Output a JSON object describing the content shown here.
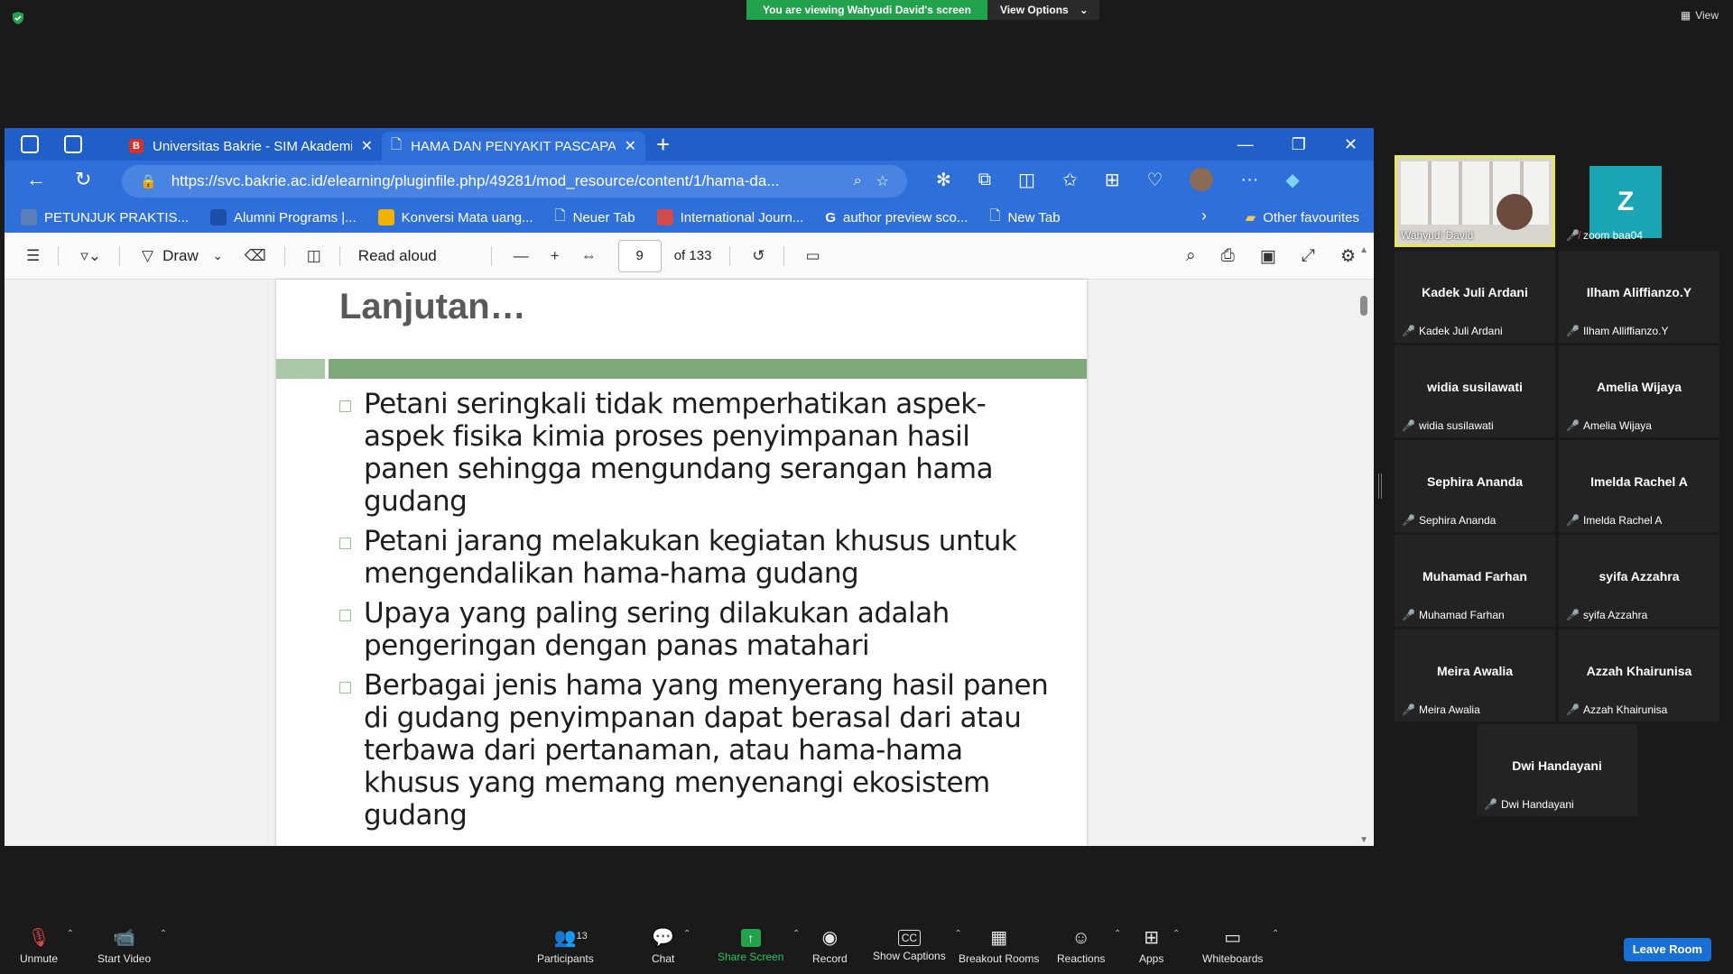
{
  "banner": {
    "viewing": "You are viewing Wahyudi David's screen",
    "view_options": "View Options",
    "view": "View"
  },
  "browser": {
    "tabs": [
      {
        "title": "Universitas Bakrie - SIM Akademi"
      },
      {
        "title": "HAMA DAN PENYAKIT PASCAPA"
      }
    ],
    "url": "https://svc.bakrie.ac.id/elearning/pluginfile.php/49281/mod_resource/content/1/hama-da...",
    "bookmarks": [
      {
        "label": "PETUNJUK PRAKTIS...",
        "color": "#5b7fb8"
      },
      {
        "label": "Alumni Programs |...",
        "color": "#1e4fa8"
      },
      {
        "label": "Konversi Mata uang...",
        "color": "#f0b400"
      },
      {
        "label": "Neuer Tab",
        "color": "#ffffff"
      },
      {
        "label": "International Journ...",
        "color": "#d04b4b"
      },
      {
        "label": "author preview sco...",
        "color": "#ffffff"
      },
      {
        "label": "New Tab",
        "color": "#ffffff"
      }
    ],
    "other_favourites": "Other favourites"
  },
  "pdf": {
    "draw": "Draw",
    "read_aloud": "Read aloud",
    "page": "9",
    "of_pages": "of 133",
    "slide": {
      "title": "Lanjutan…",
      "bullets": [
        "Petani seringkali tidak memperhatikan aspek-aspek fisika kimia proses penyimpanan hasil panen sehingga mengundang serangan hama gudang",
        "Petani jarang melakukan kegiatan khusus untuk mengendalikan hama-hama gudang",
        "Upaya yang paling sering dilakukan adalah pengeringan dengan panas matahari",
        "Berbagai jenis hama yang menyerang hasil panen di gudang penyimpanan dapat berasal dari atau terbawa dari pertanaman, atau hama-hama khusus yang memang menyenangi ekosistem gudang"
      ]
    }
  },
  "participants": {
    "host": "Wahyudi David",
    "zoom": {
      "initial": "Z",
      "name": "zoom baa04"
    },
    "tiles": [
      {
        "big": "Kadek Juli Ardani",
        "small": "Kadek Juli Ardani"
      },
      {
        "big": "Ilham Aliffianzo.Y",
        "small": "Ilham Alliffianzo.Y"
      },
      {
        "big": "widia susilawati",
        "small": "widia susilawati"
      },
      {
        "big": "Amelia Wijaya",
        "small": "Amelia Wijaya"
      },
      {
        "big": "Sephira Ananda",
        "small": "Sephira Ananda"
      },
      {
        "big": "Imelda Rachel A",
        "small": "Imelda Rachel A"
      },
      {
        "big": "Muhamad Farhan",
        "small": "Muhamad Farhan"
      },
      {
        "big": "syifa Azzahra",
        "small": "syifa Azzahra"
      },
      {
        "big": "Meira Awalia",
        "small": "Meira Awalia"
      },
      {
        "big": "Azzah Khairunisa",
        "small": "Azzah Khairunisa"
      },
      {
        "big": "Dwi Handayani",
        "small": "Dwi Handayani"
      }
    ]
  },
  "controls": {
    "unmute": "Unmute",
    "start_video": "Start Video",
    "participants": "Participants",
    "participants_count": "13",
    "chat": "Chat",
    "share_screen": "Share Screen",
    "record": "Record",
    "show_captions": "Show Captions",
    "breakout_rooms": "Breakout Rooms",
    "reactions": "Reactions",
    "apps": "Apps",
    "whiteboards": "Whiteboards",
    "leave_room": "Leave Room"
  },
  "colors": {
    "share_green": "#23a24d",
    "browser_blue": "#2f6fd9",
    "leave_blue": "#1a6fd4",
    "mic_off": "#e04a4a"
  }
}
